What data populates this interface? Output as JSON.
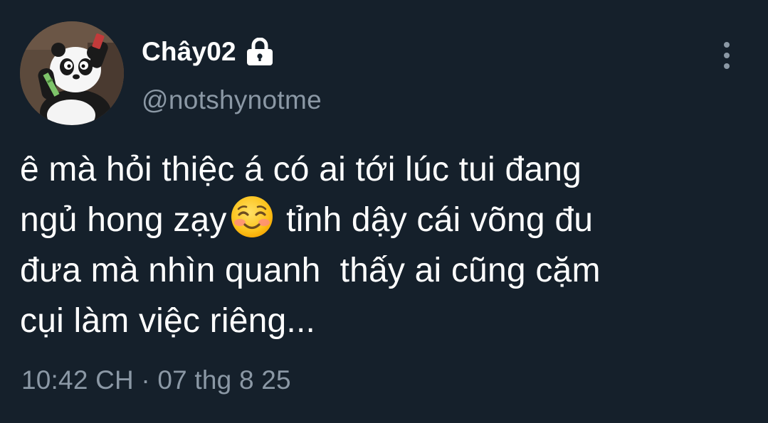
{
  "tweet": {
    "author": {
      "display_name": "Chây02",
      "handle": "@notshynotme",
      "protected": true
    },
    "text_lines": [
      "ê mà hỏi thiệc á có ai tới lúc tui đang",
      "ngủ hong zạy",
      " tỉnh dậy cái võng đu",
      "đưa mà nhìn quanh  thấy ai cũng cặm",
      "cụi làm việc riêng..."
    ],
    "timestamp": "10:42 CH · 07 thg 8 25"
  },
  "icons": {
    "lock": "lock-icon",
    "emoji": "smiling-face-with-blush-emoji",
    "menu": "more-vertical-icon"
  },
  "colors": {
    "background": "#15202b",
    "primary_text": "#ffffff",
    "secondary_text": "#8b98a5"
  }
}
